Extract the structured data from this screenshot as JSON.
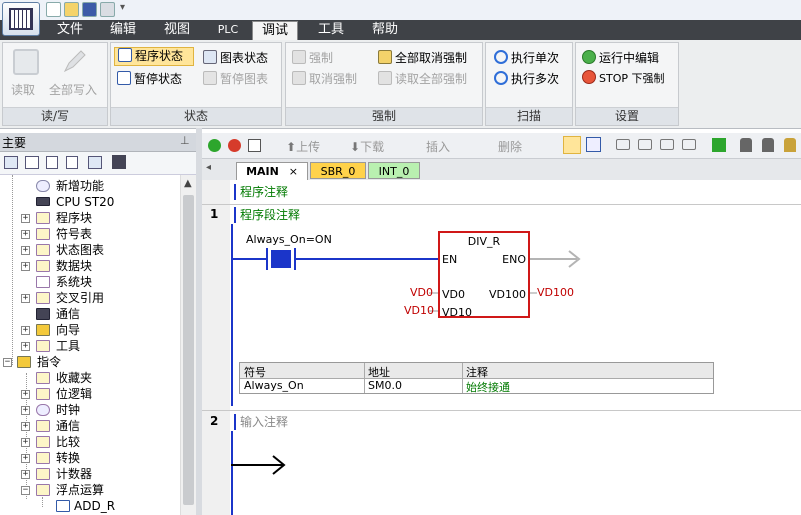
{
  "menu": {
    "tabs": [
      "文件",
      "编辑",
      "视图",
      "PLC",
      "调试",
      "工具",
      "帮助"
    ],
    "active": "调试"
  },
  "ribbon": {
    "groups": {
      "rw": {
        "caption": "读/写",
        "read": "读取",
        "write_all": "全部写入"
      },
      "status": {
        "caption": "状态",
        "program_status": "程序状态",
        "pause_status": "暂停状态",
        "chart_status": "图表状态",
        "pause_chart": "暂停图表"
      },
      "force": {
        "caption": "强制",
        "force": "强制",
        "unforce": "取消强制",
        "unforce_all": "全部取消强制",
        "read_all_forced": "读取全部强制"
      },
      "scan": {
        "caption": "扫描",
        "single": "执行单次",
        "multiple": "执行多次"
      },
      "settings": {
        "caption": "设置",
        "run_edit": "运行中编辑",
        "stop_force": "STOP 下强制"
      }
    }
  },
  "left_pane": {
    "title": "主要",
    "pin": "⊥"
  },
  "tree": {
    "items": [
      {
        "label": "新增功能"
      },
      {
        "label": "CPU ST20"
      },
      {
        "label": "程序块"
      },
      {
        "label": "符号表"
      },
      {
        "label": "状态图表"
      },
      {
        "label": "数据块"
      },
      {
        "label": "系统块"
      },
      {
        "label": "交叉引用"
      },
      {
        "label": "通信"
      },
      {
        "label": "向导"
      },
      {
        "label": "工具"
      },
      {
        "label": "指令"
      },
      {
        "label": "收藏夹"
      },
      {
        "label": "位逻辑"
      },
      {
        "label": "时钟"
      },
      {
        "label": "通信"
      },
      {
        "label": "比较"
      },
      {
        "label": "转换"
      },
      {
        "label": "计数器"
      },
      {
        "label": "浮点运算"
      },
      {
        "label": "ADD_R"
      }
    ]
  },
  "editor": {
    "toolbar": {
      "upload": "上传",
      "download": "下载",
      "insert": "插入",
      "delete": "删除"
    },
    "tabs": [
      {
        "label": "MAIN",
        "close": "×"
      },
      {
        "label": "SBR_0"
      },
      {
        "label": "INT_0"
      }
    ],
    "program_comment": "程序注释",
    "network1": {
      "number": "1",
      "comment": "程序段注释",
      "contact_label": "Always_On=ON",
      "box": {
        "name": "DIV_R",
        "en": "EN",
        "eno": "ENO",
        "in1_pin": "VD0",
        "in2_pin": "VD10",
        "out_pin": "VD100",
        "in1_value": "VD0",
        "in2_value": "VD10",
        "out_value": "VD100"
      },
      "symbol_table": {
        "headers": [
          "符号",
          "地址",
          "注释"
        ],
        "rows": [
          [
            "Always_On",
            "SM0.0",
            "始终接通"
          ]
        ]
      }
    },
    "network2": {
      "number": "2",
      "comment": "输入注释"
    }
  },
  "colors": {
    "rail": "#1b35c9",
    "box_border": "#d01818",
    "active_tab": "#ffe59a",
    "menu_bg": "#3f4247"
  }
}
